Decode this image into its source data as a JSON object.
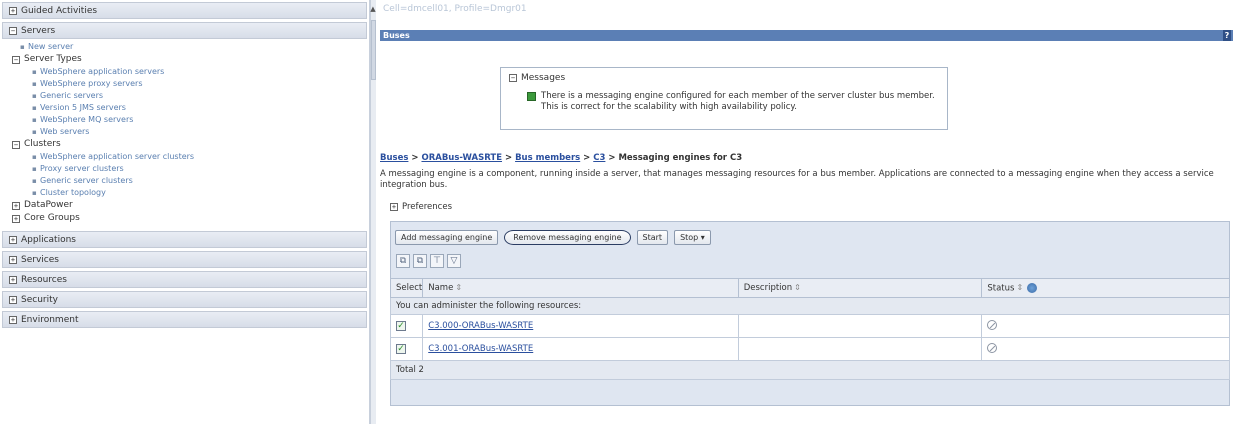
{
  "nav": {
    "guided_activities": "Guided Activities",
    "servers": "Servers",
    "new_server": "New server",
    "server_types": "Server Types",
    "server_type_items": [
      "WebSphere application servers",
      "WebSphere proxy servers",
      "Generic servers",
      "Version 5 JMS servers",
      "WebSphere MQ servers",
      "Web servers"
    ],
    "clusters": "Clusters",
    "cluster_items": [
      "WebSphere application server clusters",
      "Proxy server clusters",
      "Generic server clusters",
      "Cluster topology"
    ],
    "datapower": "DataPower",
    "core_groups": "Core Groups",
    "sections": [
      "Applications",
      "Services",
      "Resources",
      "Security",
      "Environment"
    ]
  },
  "content": {
    "scope": "Cell=dmcell01, Profile=Dmgr01",
    "title_bar": "Buses",
    "help_glyph": "?",
    "messages_title": "Messages",
    "message_text": "There is a messaging engine configured for each member of the server cluster bus member. This is correct for the scalability with high availability policy.",
    "breadcrumb": {
      "buses": "Buses",
      "bus": "ORABus-WASRTE",
      "members": "Bus members",
      "member": "C3",
      "current": "Messaging engines for C3",
      "sep": " > "
    },
    "description": "A messaging engine is a component, running inside a server, that manages messaging resources for a bus member. Applications are connected to a messaging engine when they access a service integration bus.",
    "preferences": "Preferences",
    "buttons": {
      "add": "Add messaging engine",
      "remove": "Remove messaging engine",
      "start": "Start",
      "stop": "Stop ▾"
    },
    "table": {
      "col_select": "Select",
      "col_name": "Name",
      "col_description": "Description",
      "col_status": "Status",
      "subheader": "You can administer the following resources:",
      "rows": [
        {
          "name": "C3.000-ORABus-WASRTE",
          "description": ""
        },
        {
          "name": "C3.001-ORABus-WASRTE",
          "description": ""
        }
      ],
      "total": "Total 2"
    }
  }
}
